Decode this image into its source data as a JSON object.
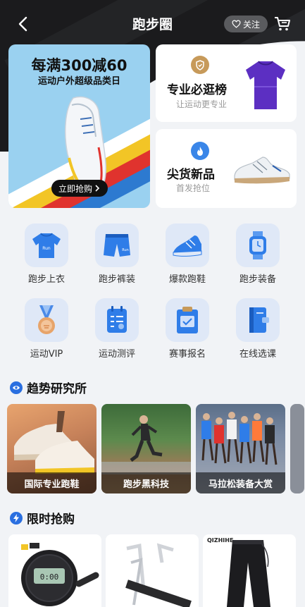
{
  "header": {
    "title": "跑步圈",
    "follow_label": "关注"
  },
  "banner": {
    "title": "每满300减60",
    "subtitle": "运动户外超级品类日",
    "button_label": "立即抢购"
  },
  "promo_cards": [
    {
      "title": "专业必逛榜",
      "subtitle": "让运动更专业"
    },
    {
      "title": "尖货新品",
      "subtitle": "首发抢位"
    }
  ],
  "categories": [
    {
      "label": "跑步上衣",
      "icon": "running-shirt-icon"
    },
    {
      "label": "跑步裤装",
      "icon": "running-shorts-icon"
    },
    {
      "label": "爆款跑鞋",
      "icon": "running-shoe-icon"
    },
    {
      "label": "跑步装备",
      "icon": "smartwatch-icon"
    },
    {
      "label": "运动VIP",
      "icon": "medal-icon"
    },
    {
      "label": "运动测评",
      "icon": "clipboard-icon"
    },
    {
      "label": "赛事报名",
      "icon": "signup-board-icon"
    },
    {
      "label": "在线选课",
      "icon": "course-book-icon"
    }
  ],
  "trend": {
    "title": "趋势研究所",
    "cards": [
      {
        "label": "国际专业跑鞋"
      },
      {
        "label": "跑步黑科技"
      },
      {
        "label": "马拉松装备大赏"
      }
    ]
  },
  "flash": {
    "title": "限时抢购",
    "brand_text": "QIZHIHE"
  },
  "colors": {
    "accent": "#2a6fe0",
    "header_bg": "#1b1b1d",
    "page_bg": "#f1f3f6"
  }
}
